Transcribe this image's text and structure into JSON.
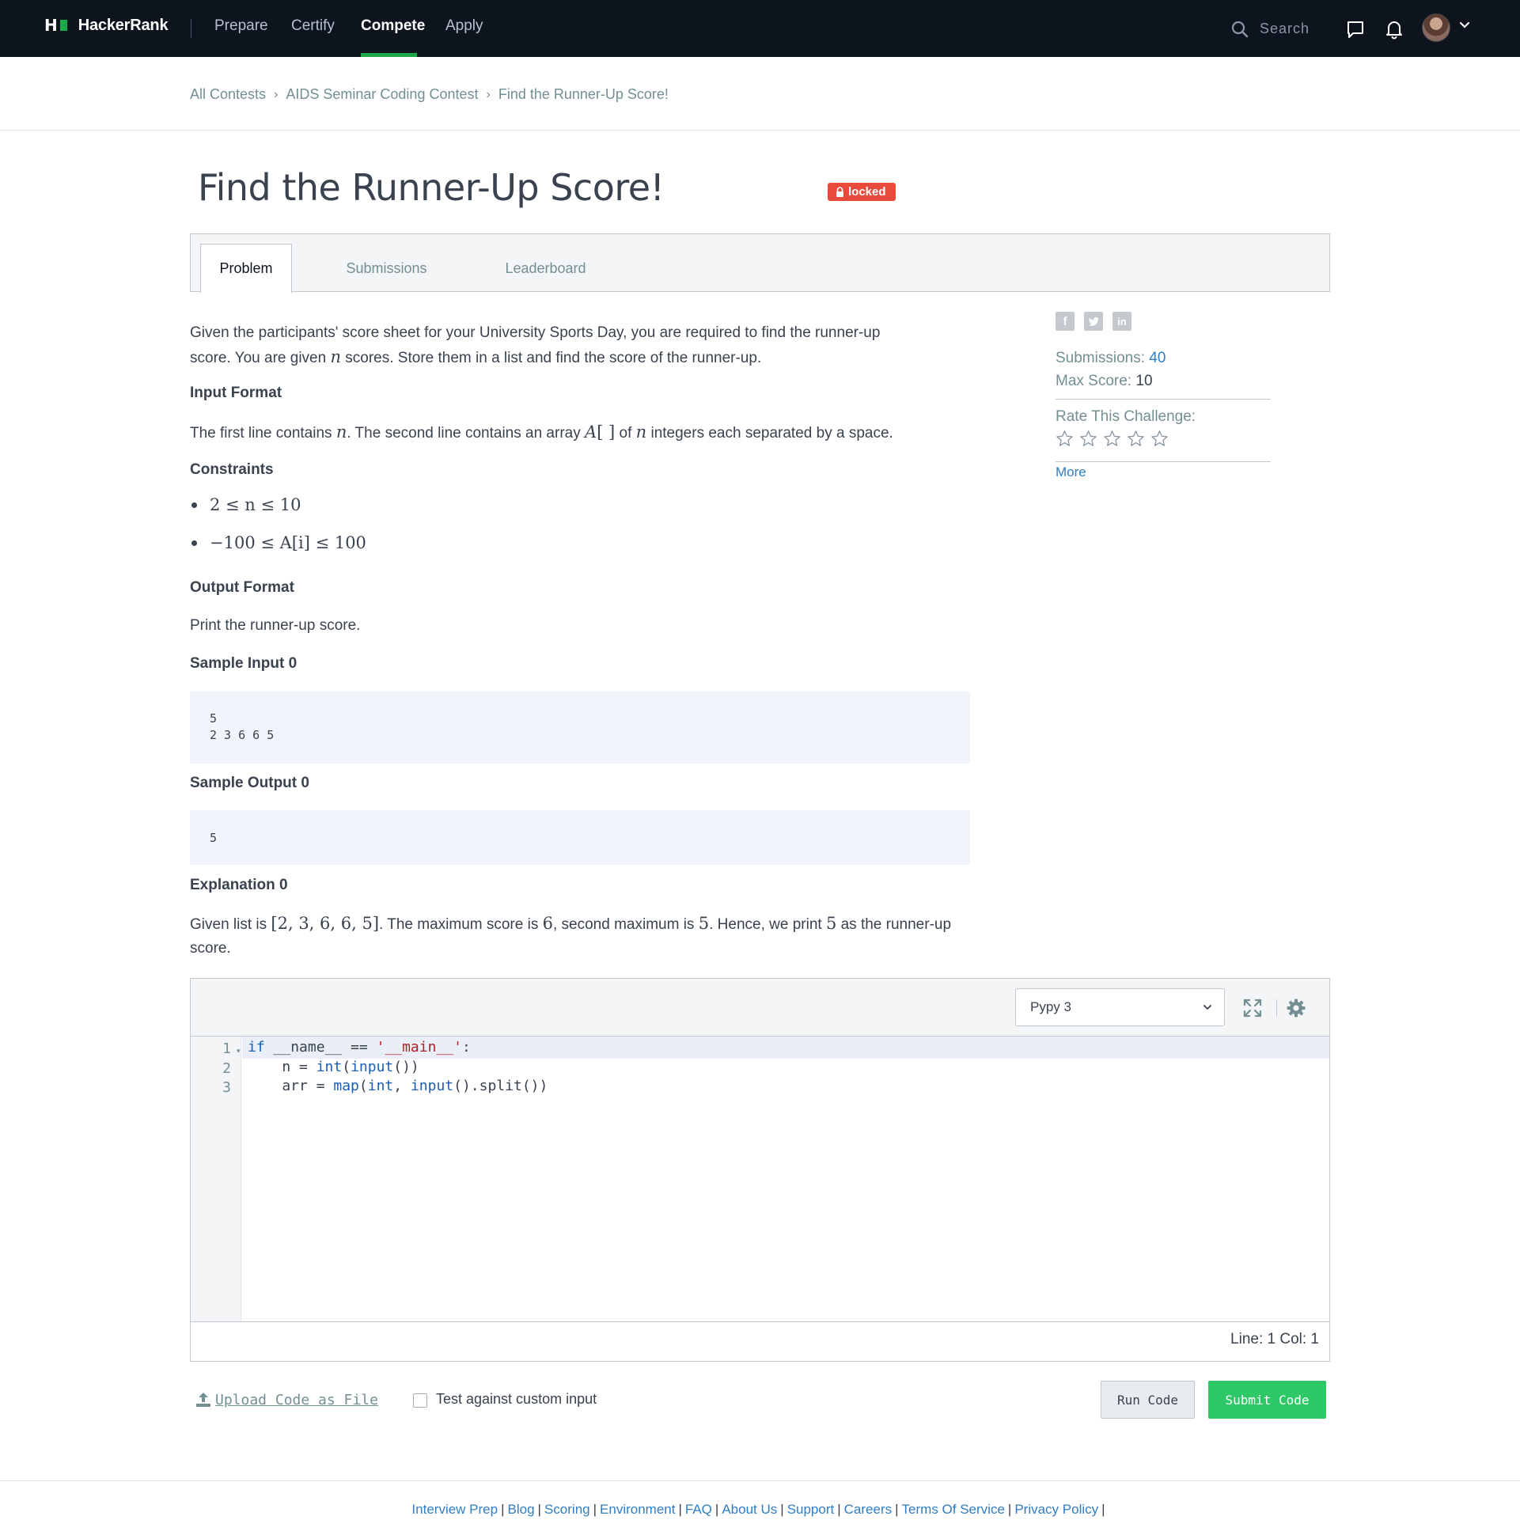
{
  "nav": {
    "brand": "HackerRank",
    "items": [
      {
        "label": "Prepare"
      },
      {
        "label": "Certify"
      },
      {
        "label": "Compete"
      },
      {
        "label": "Apply"
      }
    ],
    "active_item": "Compete",
    "search_label": "Search"
  },
  "breadcrumb": {
    "items": [
      "All Contests",
      "AIDS Seminar Coding Contest",
      "Find the Runner-Up Score!"
    ]
  },
  "challenge": {
    "title": "Find the Runner-Up Score!",
    "badge": "locked"
  },
  "tabs": [
    {
      "label": "Problem",
      "active": true
    },
    {
      "label": "Submissions",
      "active": false
    },
    {
      "label": "Leaderboard",
      "active": false
    }
  ],
  "problem": {
    "intro_1": "Given the participants' score sheet for your University Sports Day, you are required to find the runner-up",
    "intro_2a": "score. You are given",
    "intro_2_var": "n",
    "intro_2b": "scores. Store them in a list and find the score of the runner-up.",
    "input_format_heading": "Input Format",
    "input_format_a": "The first line contains",
    "input_format_var1": "n",
    "input_format_b": ". The second line contains an array",
    "input_format_arr": "A",
    "input_format_brackets": "[ ]",
    "input_format_c": "of",
    "input_format_var2": "n",
    "input_format_d": "integers each separated by a space.",
    "constraints_heading": "Constraints",
    "constraints": [
      "2 ≤ n ≤ 10",
      "−100 ≤ A[i] ≤ 100"
    ],
    "output_format_heading": "Output Format",
    "output_format": "Print the runner-up score.",
    "sample_input_heading": "Sample Input 0",
    "sample_input_lines": [
      "5",
      "2 3 6 6 5"
    ],
    "sample_output_heading": "Sample Output 0",
    "sample_output": "5",
    "explanation_heading": "Explanation 0",
    "explanation_a": "Given list is",
    "explanation_list": "[2, 3, 6, 6, 5]",
    "explanation_b": ". The maximum score is",
    "explanation_max": "6",
    "explanation_c": ", second maximum is",
    "explanation_second": "5",
    "explanation_d": ". Hence, we print",
    "explanation_print": "5",
    "explanation_e": "as the runner-up",
    "explanation_f": "score."
  },
  "sidebar": {
    "social_icons": [
      "facebook-icon",
      "twitter-icon",
      "linkedin-icon"
    ],
    "submissions_label": "Submissions:",
    "submissions_value": "40",
    "max_score_label": "Max Score:",
    "max_score_value": "10",
    "rate_label": "Rate This Challenge:",
    "rating": 0,
    "rating_max": 5,
    "more_link": "More"
  },
  "editor": {
    "language": "Pypy 3",
    "line_numbers": [
      "1",
      "2",
      "3"
    ],
    "status": "Line: 1 Col: 1"
  },
  "actions": {
    "upload_label": "Upload Code as File",
    "custom_input_label": "Test against custom input",
    "custom_input_checked": false,
    "run_label": "Run Code",
    "submit_label": "Submit Code"
  },
  "footer": {
    "links": [
      "Interview Prep",
      "Blog",
      "Scoring",
      "Environment",
      "FAQ",
      "About Us",
      "Support",
      "Careers",
      "Terms Of Service",
      "Privacy Policy"
    ]
  },
  "colors": {
    "nav_bg": "#0e141e",
    "accent_green": "#1ba94c",
    "submit_green": "#2ec866",
    "locked_red": "#e84b3c",
    "link_blue": "#2f7dc4"
  }
}
